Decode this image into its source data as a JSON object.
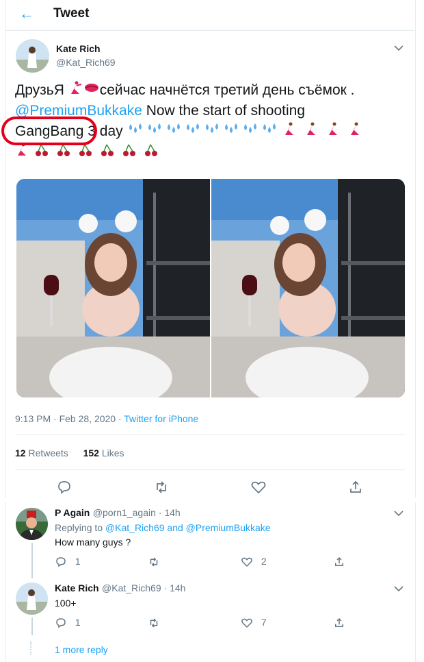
{
  "header": {
    "back_icon": "arrow-left-icon",
    "title": "Tweet"
  },
  "tweet": {
    "author_name": "Kate Rich",
    "author_handle": "@Kat_Rich69",
    "text_line1": "ДрузьЯ",
    "text_line1b": "сейчас начнётся третий день съёмок .",
    "mention": "@PremiumBukkake",
    "text_line2b": " Now the start of shooting",
    "hashword": "GangBang",
    "text_line3b": " 3 day",
    "timestamp": "9:13 PM · Feb 28, 2020 · ",
    "source": "Twitter for iPhone",
    "retweets_count": "12",
    "retweets_label": " Retweets",
    "likes_count": "152",
    "likes_label": " Likes"
  },
  "replies": [
    {
      "name": "P Again",
      "handle": "@porn1_again · 14h",
      "replying_prefix": "Replying to ",
      "replying_to": "@Kat_Rich69 and @PremiumBukkake",
      "text": "How many guys ?",
      "reply_count": "1",
      "like_count": "2"
    },
    {
      "name": "Kate Rich",
      "handle": "@Kat_Rich69 · 14h",
      "text": "100+",
      "reply_count": "1",
      "like_count": "7"
    }
  ],
  "more_replies": "1 more reply",
  "colors": {
    "accent": "#1da1f2",
    "annotation": "#e2001a",
    "muted": "#657786"
  }
}
